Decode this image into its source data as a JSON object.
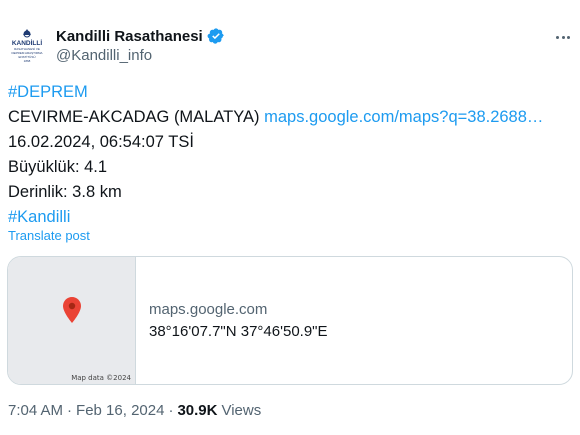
{
  "author": {
    "display_name": "Kandilli Rasathanesi",
    "handle": "@Kandilli_info",
    "avatar_lines": [
      "KANDİLLİ",
      "RASATHANESİ VE",
      "DEPREM ARAŞTIRMA",
      "ENSTİTÜSÜ",
      "1868"
    ]
  },
  "tweet": {
    "hashtag1": "#DEPREM",
    "location": "CEVIRME-AKCADAG (MALATYA)",
    "map_link": "maps.google.com/maps?q=38.2688…",
    "datetime": "16.02.2024, 06:54:07 TSİ",
    "magnitude": "Büyüklük: 4.1",
    "depth": "Derinlik: 3.8 km",
    "hashtag2": "#Kandilli"
  },
  "translate_label": "Translate post",
  "card": {
    "domain": "maps.google.com",
    "coords": "38°16'07.7\"N 37°46'50.9\"E",
    "map_credit": "Map data ©2024"
  },
  "meta": {
    "time": "7:04 AM",
    "separator": "·",
    "date": "Feb 16, 2024",
    "separator2": "·",
    "views_count": "30.9K",
    "views_label": "Views"
  },
  "colors": {
    "link": "#1d9bf0",
    "secondary_text": "#536471",
    "primary_text": "#0f1419",
    "border": "#cfd9de",
    "pin": "#ea4335"
  },
  "icons": [
    "verified-badge-icon",
    "more-options-icon",
    "map-pin-icon"
  ]
}
